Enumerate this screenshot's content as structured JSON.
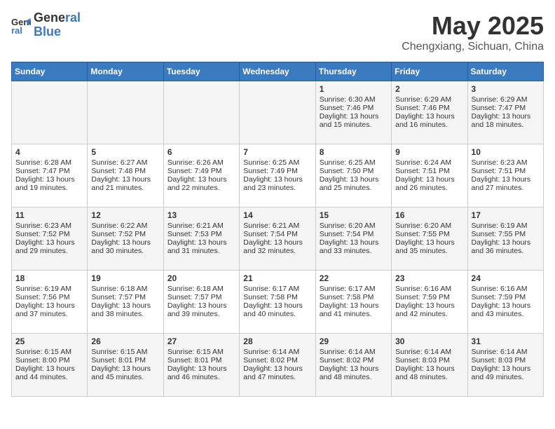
{
  "header": {
    "logo_line1": "General",
    "logo_line2": "Blue",
    "month": "May 2025",
    "location": "Chengxiang, Sichuan, China"
  },
  "weekdays": [
    "Sunday",
    "Monday",
    "Tuesday",
    "Wednesday",
    "Thursday",
    "Friday",
    "Saturday"
  ],
  "weeks": [
    [
      {
        "day": "",
        "text": ""
      },
      {
        "day": "",
        "text": ""
      },
      {
        "day": "",
        "text": ""
      },
      {
        "day": "",
        "text": ""
      },
      {
        "day": "1",
        "text": "Sunrise: 6:30 AM\nSunset: 7:46 PM\nDaylight: 13 hours and 15 minutes."
      },
      {
        "day": "2",
        "text": "Sunrise: 6:29 AM\nSunset: 7:46 PM\nDaylight: 13 hours and 16 minutes."
      },
      {
        "day": "3",
        "text": "Sunrise: 6:29 AM\nSunset: 7:47 PM\nDaylight: 13 hours and 18 minutes."
      }
    ],
    [
      {
        "day": "4",
        "text": "Sunrise: 6:28 AM\nSunset: 7:47 PM\nDaylight: 13 hours and 19 minutes."
      },
      {
        "day": "5",
        "text": "Sunrise: 6:27 AM\nSunset: 7:48 PM\nDaylight: 13 hours and 21 minutes."
      },
      {
        "day": "6",
        "text": "Sunrise: 6:26 AM\nSunset: 7:49 PM\nDaylight: 13 hours and 22 minutes."
      },
      {
        "day": "7",
        "text": "Sunrise: 6:25 AM\nSunset: 7:49 PM\nDaylight: 13 hours and 23 minutes."
      },
      {
        "day": "8",
        "text": "Sunrise: 6:25 AM\nSunset: 7:50 PM\nDaylight: 13 hours and 25 minutes."
      },
      {
        "day": "9",
        "text": "Sunrise: 6:24 AM\nSunset: 7:51 PM\nDaylight: 13 hours and 26 minutes."
      },
      {
        "day": "10",
        "text": "Sunrise: 6:23 AM\nSunset: 7:51 PM\nDaylight: 13 hours and 27 minutes."
      }
    ],
    [
      {
        "day": "11",
        "text": "Sunrise: 6:23 AM\nSunset: 7:52 PM\nDaylight: 13 hours and 29 minutes."
      },
      {
        "day": "12",
        "text": "Sunrise: 6:22 AM\nSunset: 7:52 PM\nDaylight: 13 hours and 30 minutes."
      },
      {
        "day": "13",
        "text": "Sunrise: 6:21 AM\nSunset: 7:53 PM\nDaylight: 13 hours and 31 minutes."
      },
      {
        "day": "14",
        "text": "Sunrise: 6:21 AM\nSunset: 7:54 PM\nDaylight: 13 hours and 32 minutes."
      },
      {
        "day": "15",
        "text": "Sunrise: 6:20 AM\nSunset: 7:54 PM\nDaylight: 13 hours and 33 minutes."
      },
      {
        "day": "16",
        "text": "Sunrise: 6:20 AM\nSunset: 7:55 PM\nDaylight: 13 hours and 35 minutes."
      },
      {
        "day": "17",
        "text": "Sunrise: 6:19 AM\nSunset: 7:55 PM\nDaylight: 13 hours and 36 minutes."
      }
    ],
    [
      {
        "day": "18",
        "text": "Sunrise: 6:19 AM\nSunset: 7:56 PM\nDaylight: 13 hours and 37 minutes."
      },
      {
        "day": "19",
        "text": "Sunrise: 6:18 AM\nSunset: 7:57 PM\nDaylight: 13 hours and 38 minutes."
      },
      {
        "day": "20",
        "text": "Sunrise: 6:18 AM\nSunset: 7:57 PM\nDaylight: 13 hours and 39 minutes."
      },
      {
        "day": "21",
        "text": "Sunrise: 6:17 AM\nSunset: 7:58 PM\nDaylight: 13 hours and 40 minutes."
      },
      {
        "day": "22",
        "text": "Sunrise: 6:17 AM\nSunset: 7:58 PM\nDaylight: 13 hours and 41 minutes."
      },
      {
        "day": "23",
        "text": "Sunrise: 6:16 AM\nSunset: 7:59 PM\nDaylight: 13 hours and 42 minutes."
      },
      {
        "day": "24",
        "text": "Sunrise: 6:16 AM\nSunset: 7:59 PM\nDaylight: 13 hours and 43 minutes."
      }
    ],
    [
      {
        "day": "25",
        "text": "Sunrise: 6:15 AM\nSunset: 8:00 PM\nDaylight: 13 hours and 44 minutes."
      },
      {
        "day": "26",
        "text": "Sunrise: 6:15 AM\nSunset: 8:01 PM\nDaylight: 13 hours and 45 minutes."
      },
      {
        "day": "27",
        "text": "Sunrise: 6:15 AM\nSunset: 8:01 PM\nDaylight: 13 hours and 46 minutes."
      },
      {
        "day": "28",
        "text": "Sunrise: 6:14 AM\nSunset: 8:02 PM\nDaylight: 13 hours and 47 minutes."
      },
      {
        "day": "29",
        "text": "Sunrise: 6:14 AM\nSunset: 8:02 PM\nDaylight: 13 hours and 48 minutes."
      },
      {
        "day": "30",
        "text": "Sunrise: 6:14 AM\nSunset: 8:03 PM\nDaylight: 13 hours and 48 minutes."
      },
      {
        "day": "31",
        "text": "Sunrise: 6:14 AM\nSunset: 8:03 PM\nDaylight: 13 hours and 49 minutes."
      }
    ]
  ]
}
